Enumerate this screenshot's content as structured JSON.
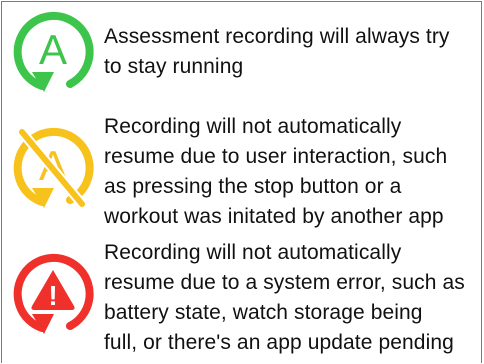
{
  "legend": {
    "items": [
      {
        "icon": "recording-running-icon",
        "color": "#3cc54a",
        "glyph": "A",
        "text": "Assessment recording will always try\nto stay running"
      },
      {
        "icon": "recording-paused-user-icon",
        "color": "#f7c21b",
        "glyph": "A",
        "text": "Recording will not automatically\nresume due to user interaction, such\nas pressing the stop button or a\nworkout was initated by another app"
      },
      {
        "icon": "recording-error-icon",
        "color": "#f0302a",
        "glyph": "!",
        "text": "Recording will not automatically\nresume due to a system error, such as\nbattery state, watch storage being\nfull, or there's an app update pending"
      }
    ]
  }
}
